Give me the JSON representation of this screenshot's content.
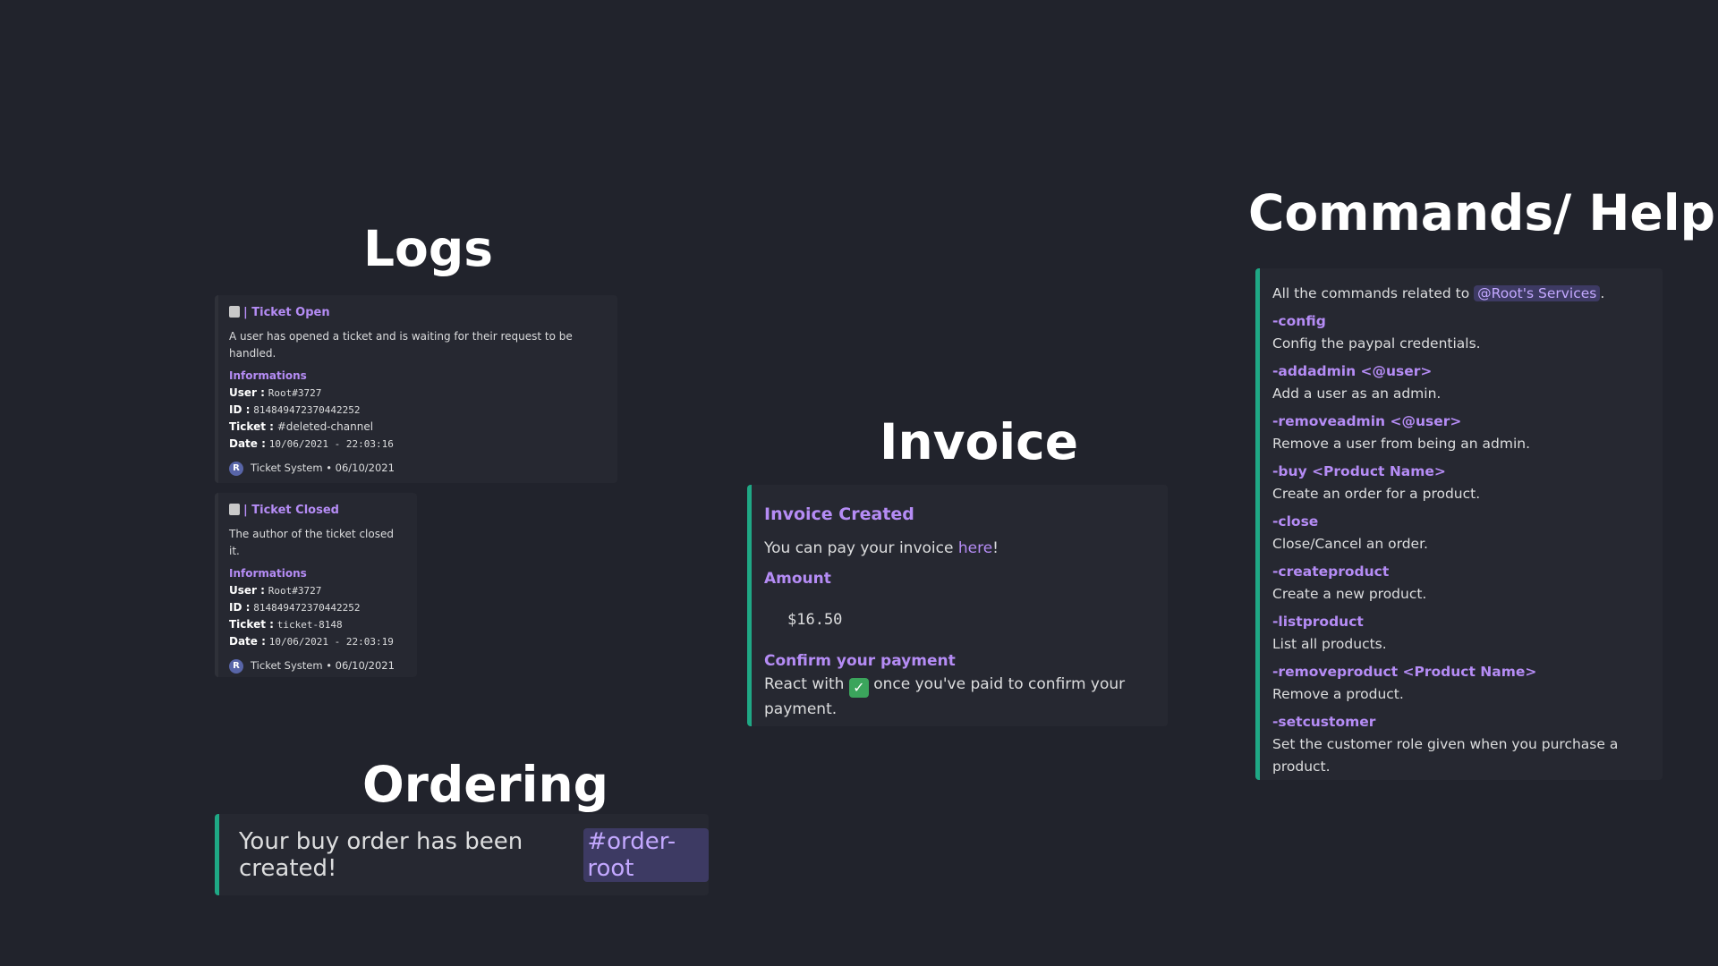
{
  "headings": {
    "logs": "Logs",
    "invoice": "Invoice",
    "commands": "Commands/ Help",
    "ordering": "Ordering"
  },
  "logs": {
    "open": {
      "title": "| Ticket Open",
      "description": "A user has opened a ticket and is waiting for their request to be handled.",
      "field_title": "Informations",
      "user_label": "User :",
      "user_value": "Root#3727",
      "id_label": "ID :",
      "id_value": "814849472370442252",
      "ticket_label": "Ticket :",
      "ticket_value": "#deleted-channel",
      "date_label": "Date :",
      "date_value": "10/06/2021 - 22:03:16",
      "footer": "Ticket System • 06/10/2021",
      "icon": "notepad-icon"
    },
    "closed": {
      "title": "| Ticket Closed",
      "description": "The author of the ticket closed it.",
      "field_title": "Informations",
      "user_label": "User :",
      "user_value": "Root#3727",
      "id_label": "ID :",
      "id_value": "814849472370442252",
      "ticket_label": "Ticket :",
      "ticket_value": "ticket-8148",
      "date_label": "Date :",
      "date_value": "10/06/2021 - 22:03:19",
      "footer": "Ticket System • 06/10/2021",
      "icon": "trash-icon"
    },
    "avatar_letter": "R"
  },
  "invoice": {
    "title": "Invoice Created",
    "pay_prefix": "You can pay your invoice ",
    "pay_link": "here",
    "pay_suffix": "!",
    "amount_title": "Amount",
    "amount_value": "$16.50",
    "confirm_title": "Confirm your payment",
    "confirm_prefix": "React with",
    "confirm_suffix": " once you've paid to confirm your payment.",
    "check_glyph": "✓"
  },
  "commands": {
    "intro_prefix": "All the commands related to ",
    "intro_mention": "@Root's Services",
    "intro_suffix": ".",
    "items": [
      {
        "cmd": "-config",
        "desc": "Config the paypal credentials."
      },
      {
        "cmd": "-addadmin <@user>",
        "desc": "Add a user as an admin."
      },
      {
        "cmd": "-removeadmin <@user>",
        "desc": "Remove a user from being an admin."
      },
      {
        "cmd": "-buy <Product Name>",
        "desc": "Create an order for a product."
      },
      {
        "cmd": "-close",
        "desc": "Close/Cancel an order."
      },
      {
        "cmd": "-createproduct",
        "desc": "Create a new product."
      },
      {
        "cmd": "-listproduct",
        "desc": "List all products."
      },
      {
        "cmd": "-removeproduct <Product Name>",
        "desc": "Remove a product."
      },
      {
        "cmd": "-setcustomer",
        "desc": "Set the customer role given when you purchase a product."
      }
    ]
  },
  "ordering": {
    "text": "Your buy order has been created! ",
    "channel": "#order-root"
  },
  "colors": {
    "background": "#21232c",
    "embed_bar": "#1fa885",
    "accent_purple": "#b58cf5"
  }
}
